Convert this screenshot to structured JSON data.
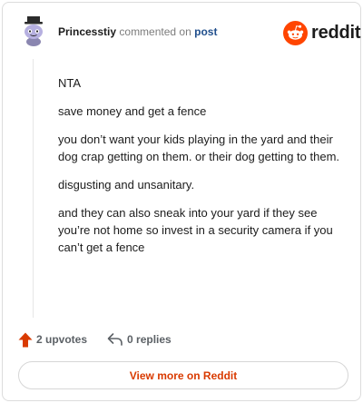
{
  "header": {
    "username": "Princesstiy",
    "action_text": "commented on",
    "post_link": "post",
    "avatar_icon": "snoo-avatar-icon",
    "brand": {
      "icon": "reddit-snoo-logo-icon",
      "wordmark": "reddit",
      "color": "#ff4500"
    }
  },
  "comment": {
    "paragraphs": [
      "NTA",
      "save money and get a fence",
      "you don’t want your kids playing in the yard and their dog crap getting on them. or their dog getting to them.",
      "disgusting and unsanitary.",
      "and they can also sneak into your yard if they see you’re not home so invest in a security camera if you can’t get a fence"
    ]
  },
  "actions": {
    "upvotes": {
      "icon": "upvote-arrow-icon",
      "label": "2 upvotes",
      "color": "#d93a00"
    },
    "replies": {
      "icon": "reply-arrow-icon",
      "label": "0 replies"
    }
  },
  "footer": {
    "view_more_label": "View more on Reddit",
    "accent_color": "#d93a00"
  }
}
